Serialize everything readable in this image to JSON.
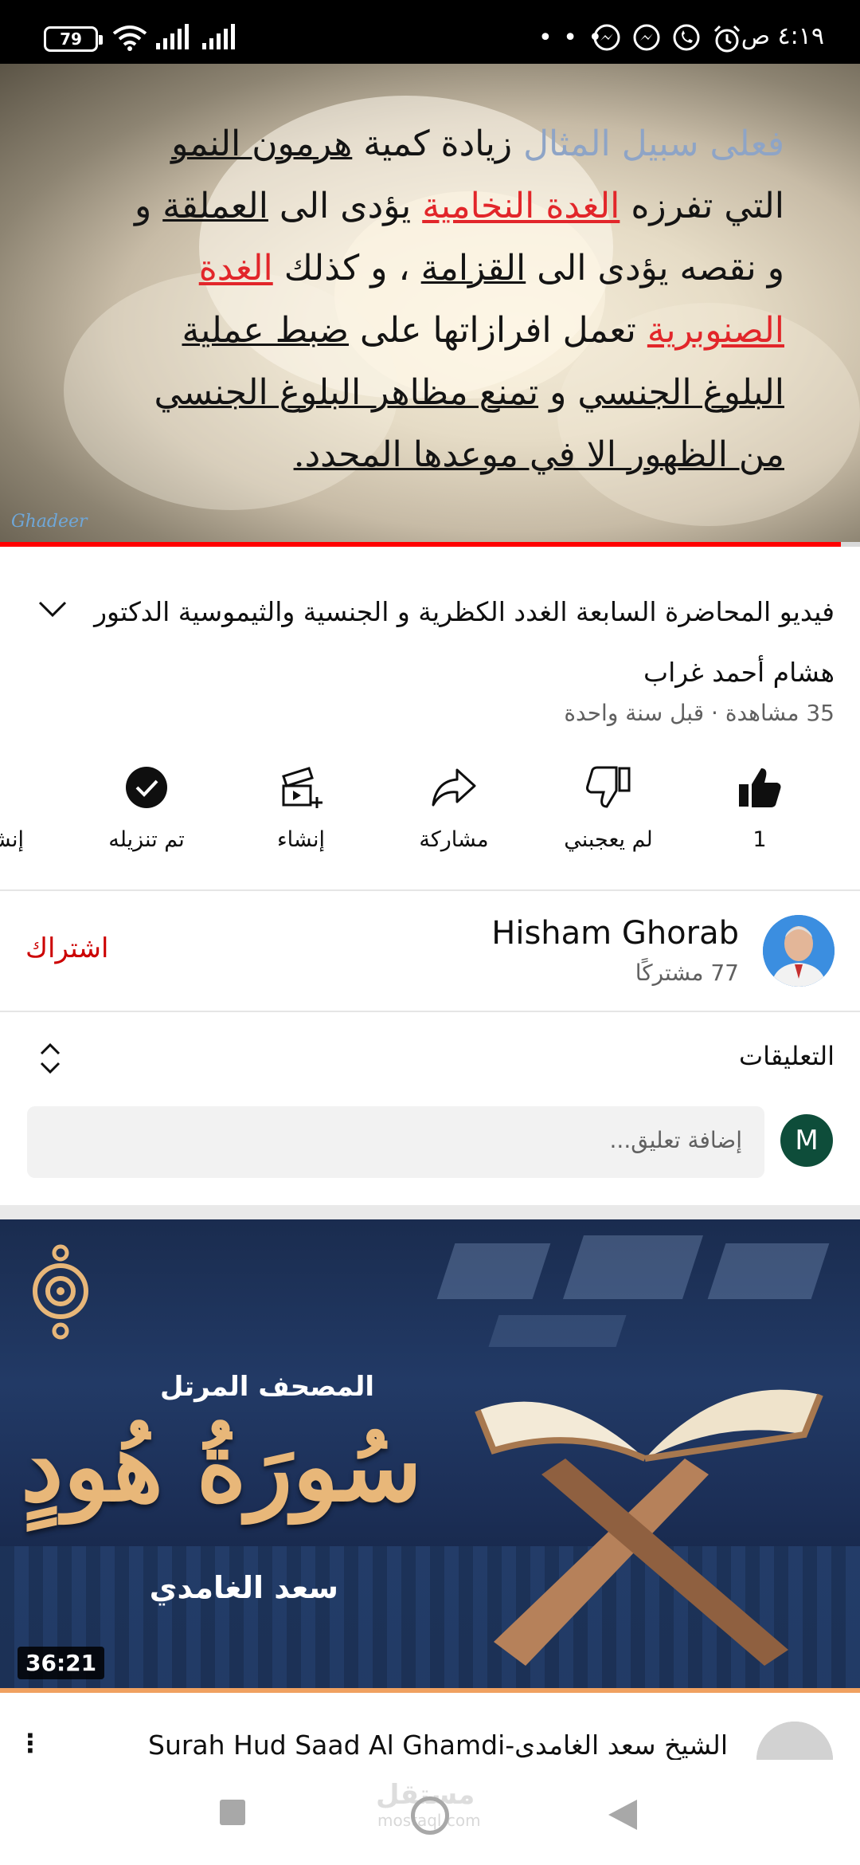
{
  "status_bar": {
    "battery": "79",
    "time": "٤:١٩ ص",
    "overflow_dots": "• • •"
  },
  "player": {
    "slide_lines": [
      {
        "parts": [
          {
            "text": "فعلى سبيل المثال",
            "style": "blue"
          },
          {
            "text": " زيادة كمية ",
            "style": "plain"
          },
          {
            "text": "هرمون النمو",
            "style": "u"
          }
        ]
      },
      {
        "parts": [
          {
            "text": "التي تفرزه ",
            "style": "plain"
          },
          {
            "text": "الغدة النخامية",
            "style": "red"
          },
          {
            "text": " يؤدى الى ",
            "style": "plain"
          },
          {
            "text": "العملقة",
            "style": "u"
          },
          {
            "text": " و",
            "style": "plain"
          }
        ]
      },
      {
        "parts": [
          {
            "text": "و نقصه يؤدى الى ",
            "style": "plain"
          },
          {
            "text": "القزامة",
            "style": "u"
          },
          {
            "text": " ، و كذلك ",
            "style": "plain"
          },
          {
            "text": "الغدة",
            "style": "red"
          }
        ]
      },
      {
        "parts": [
          {
            "text": "الصنوبرية",
            "style": "red"
          },
          {
            "text": " تعمل افرازاتها على ",
            "style": "plain"
          },
          {
            "text": "ضبط عملية",
            "style": "u"
          }
        ]
      },
      {
        "parts": [
          {
            "text": "البلوغ الجنسي",
            "style": "u"
          },
          {
            "text": " و ",
            "style": "plain"
          },
          {
            "text": "تمنع مظاهر البلوغ الجنسي",
            "style": "u"
          }
        ]
      },
      {
        "parts": [
          {
            "text": "من الظهور الا في موعدها المحدد.",
            "style": "u"
          }
        ]
      }
    ],
    "watermark": "Ghadeer",
    "progress": 0.978
  },
  "video": {
    "title": "فيديو المحاضرة السابعة الغدد الكظرية و الجنسية والثيموسية الدكتور هشام أحمد غراب",
    "meta": "35 مشاهدة · قبل سنة واحدة"
  },
  "actions": {
    "like_count": "1",
    "dislike": "لم يعجبني",
    "share": "مشاركة",
    "create": "إنشاء",
    "downloaded": "تم تنزيله",
    "clip": "إنشاء"
  },
  "channel": {
    "name": "Hisham Ghorab",
    "subscribers": "77 مشتركًا",
    "subscribe_label": "اشتراك"
  },
  "comments": {
    "title": "التعليقات",
    "user_initial": "M",
    "placeholder": "إضافة تعليق..."
  },
  "next_video": {
    "thumb_line1": "المصحف المرتل",
    "thumb_calligraphy": "سُورَةُ هُودٍ",
    "thumb_reciter": "سعد الغامدي",
    "duration": "36:21",
    "title": "الشيخ سعد الغامدى-Surah Hud Saad Al Ghamdi"
  },
  "watermark_site": {
    "name": "مستقل",
    "domain": "mostaql.com"
  },
  "colors": {
    "accent_red": "#ff0000",
    "subscribe_red": "#cc0000",
    "avatar_green": "#0e4d3a",
    "thumb_orange": "#f0a160"
  }
}
